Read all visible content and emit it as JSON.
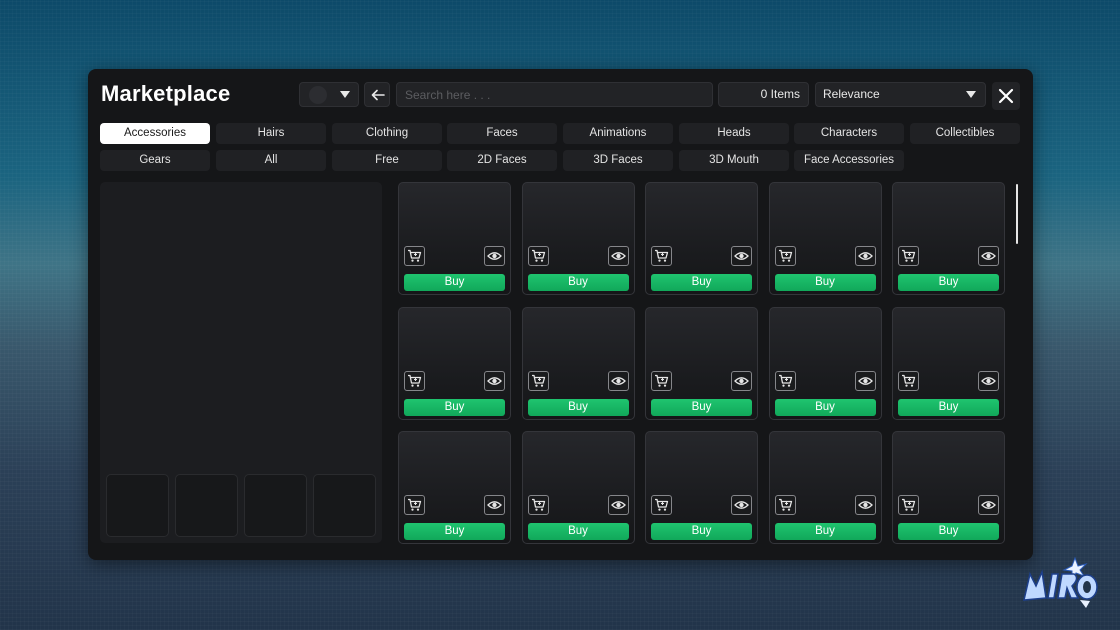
{
  "header": {
    "title": "Marketplace",
    "search_placeholder": "Search here . . .",
    "items_count": "0 Items",
    "sort_selected": "Relevance"
  },
  "tabs": [
    {
      "label": "Accessories",
      "active": true
    },
    {
      "label": "Hairs"
    },
    {
      "label": "Clothing"
    },
    {
      "label": "Faces"
    },
    {
      "label": "Animations"
    },
    {
      "label": "Heads"
    },
    {
      "label": "Characters"
    },
    {
      "label": "Collectibles"
    },
    {
      "label": "Gears"
    },
    {
      "label": "All"
    },
    {
      "label": "Free"
    },
    {
      "label": "2D Faces"
    },
    {
      "label": "3D Faces"
    },
    {
      "label": "3D Mouth"
    },
    {
      "label": "Face Accessories"
    }
  ],
  "grid": {
    "rows": 3,
    "columns": 5,
    "buy_label": "Buy",
    "cart_icon": "shopping-cart-icon",
    "view_icon": "eye-icon"
  },
  "preview": {
    "slot_count": 4
  },
  "logo": {
    "text": "MIRO"
  },
  "colors": {
    "buy_green": "#16b463",
    "panel_bg": "#151618",
    "tab_active_bg": "#ffffff"
  }
}
